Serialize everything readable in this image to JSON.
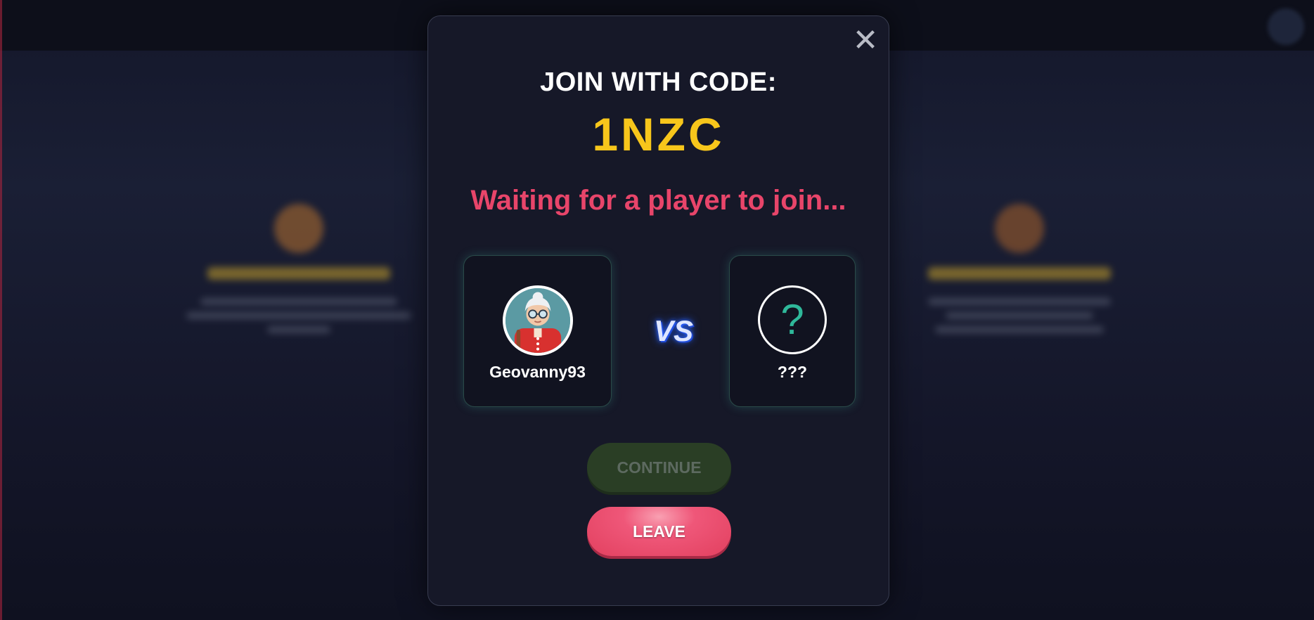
{
  "modal": {
    "title": "JOIN WITH CODE:",
    "code": "1NZC",
    "status": "Waiting for a player to join...",
    "close_icon": "close-icon"
  },
  "players": {
    "host": {
      "name": "Geovanny93",
      "avatar": "grandma-avatar"
    },
    "vs_label": "VS",
    "opponent": {
      "name": "???",
      "avatar_glyph": "?"
    }
  },
  "buttons": {
    "continue_label": "CONTINUE",
    "leave_label": "LEAVE"
  },
  "colors": {
    "code": "#f7c61b",
    "status": "#e8456a",
    "question_mark": "#2fb89a",
    "leave_button": "#e2405f",
    "continue_button_disabled": "#2a3e25"
  }
}
